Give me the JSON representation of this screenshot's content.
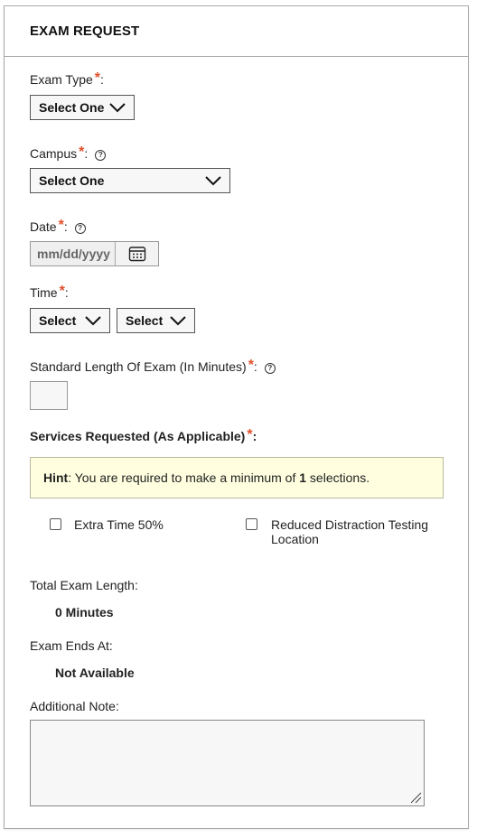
{
  "header": {
    "title": "EXAM REQUEST"
  },
  "required_mark": "*",
  "help_glyph": "?",
  "exam_type": {
    "label": "Exam Type",
    "colon": ":",
    "selected": "Select One"
  },
  "campus": {
    "label": "Campus",
    "colon": ":",
    "selected": "Select One"
  },
  "date": {
    "label": "Date",
    "colon": ":",
    "placeholder": "mm/dd/yyyy"
  },
  "time": {
    "label": "Time",
    "colon": ":",
    "hour_selected": "Select",
    "minute_selected": "Select"
  },
  "standard_length": {
    "label": "Standard Length Of Exam (In Minutes)",
    "colon": ":",
    "value": ""
  },
  "services": {
    "label": "Services Requested (As Applicable)",
    "colon": ":",
    "hint_prefix": "Hint",
    "hint_text_1": ": You are required to make a minimum of ",
    "hint_count": "1",
    "hint_text_2": " selections.",
    "options": [
      {
        "label": "Extra Time 50%",
        "checked": false
      },
      {
        "label_line1": "Reduced Distraction Testing",
        "label_line2": "Location",
        "checked": false
      }
    ]
  },
  "total_exam_length": {
    "label": "Total Exam Length:",
    "value": "0 Minutes"
  },
  "exam_ends_at": {
    "label": "Exam Ends At:",
    "value": "Not Available"
  },
  "additional_note": {
    "label": "Additional Note:",
    "value": ""
  },
  "colors": {
    "required": "#e0502a",
    "hint_bg": "#ffffe0",
    "border": "#a8a8a8"
  }
}
